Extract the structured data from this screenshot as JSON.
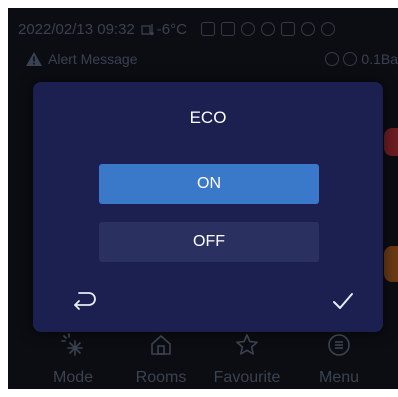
{
  "status_bar": {
    "datetime": "2022/02/13 09:32",
    "outdoor_temp": "-6°C"
  },
  "alert": {
    "message": "Alert Message",
    "pressure": "0.1Ba"
  },
  "dialog": {
    "title": "ECO",
    "on_label": "ON",
    "off_label": "OFF",
    "selected": "ON"
  },
  "nav": {
    "items": [
      {
        "label": "Mode",
        "icon": "snowflake-sun-icon"
      },
      {
        "label": "Rooms",
        "icon": "home-icon"
      },
      {
        "label": "Favourite",
        "icon": "star-icon"
      },
      {
        "label": "Menu",
        "icon": "menu-icon"
      }
    ]
  },
  "colors": {
    "screen_bg": "#0b0d12",
    "dialog_bg": "#1b2050",
    "selected_button": "#3a78c9",
    "unselected_button": "#2a3160",
    "dim_text": "#3a4152"
  }
}
